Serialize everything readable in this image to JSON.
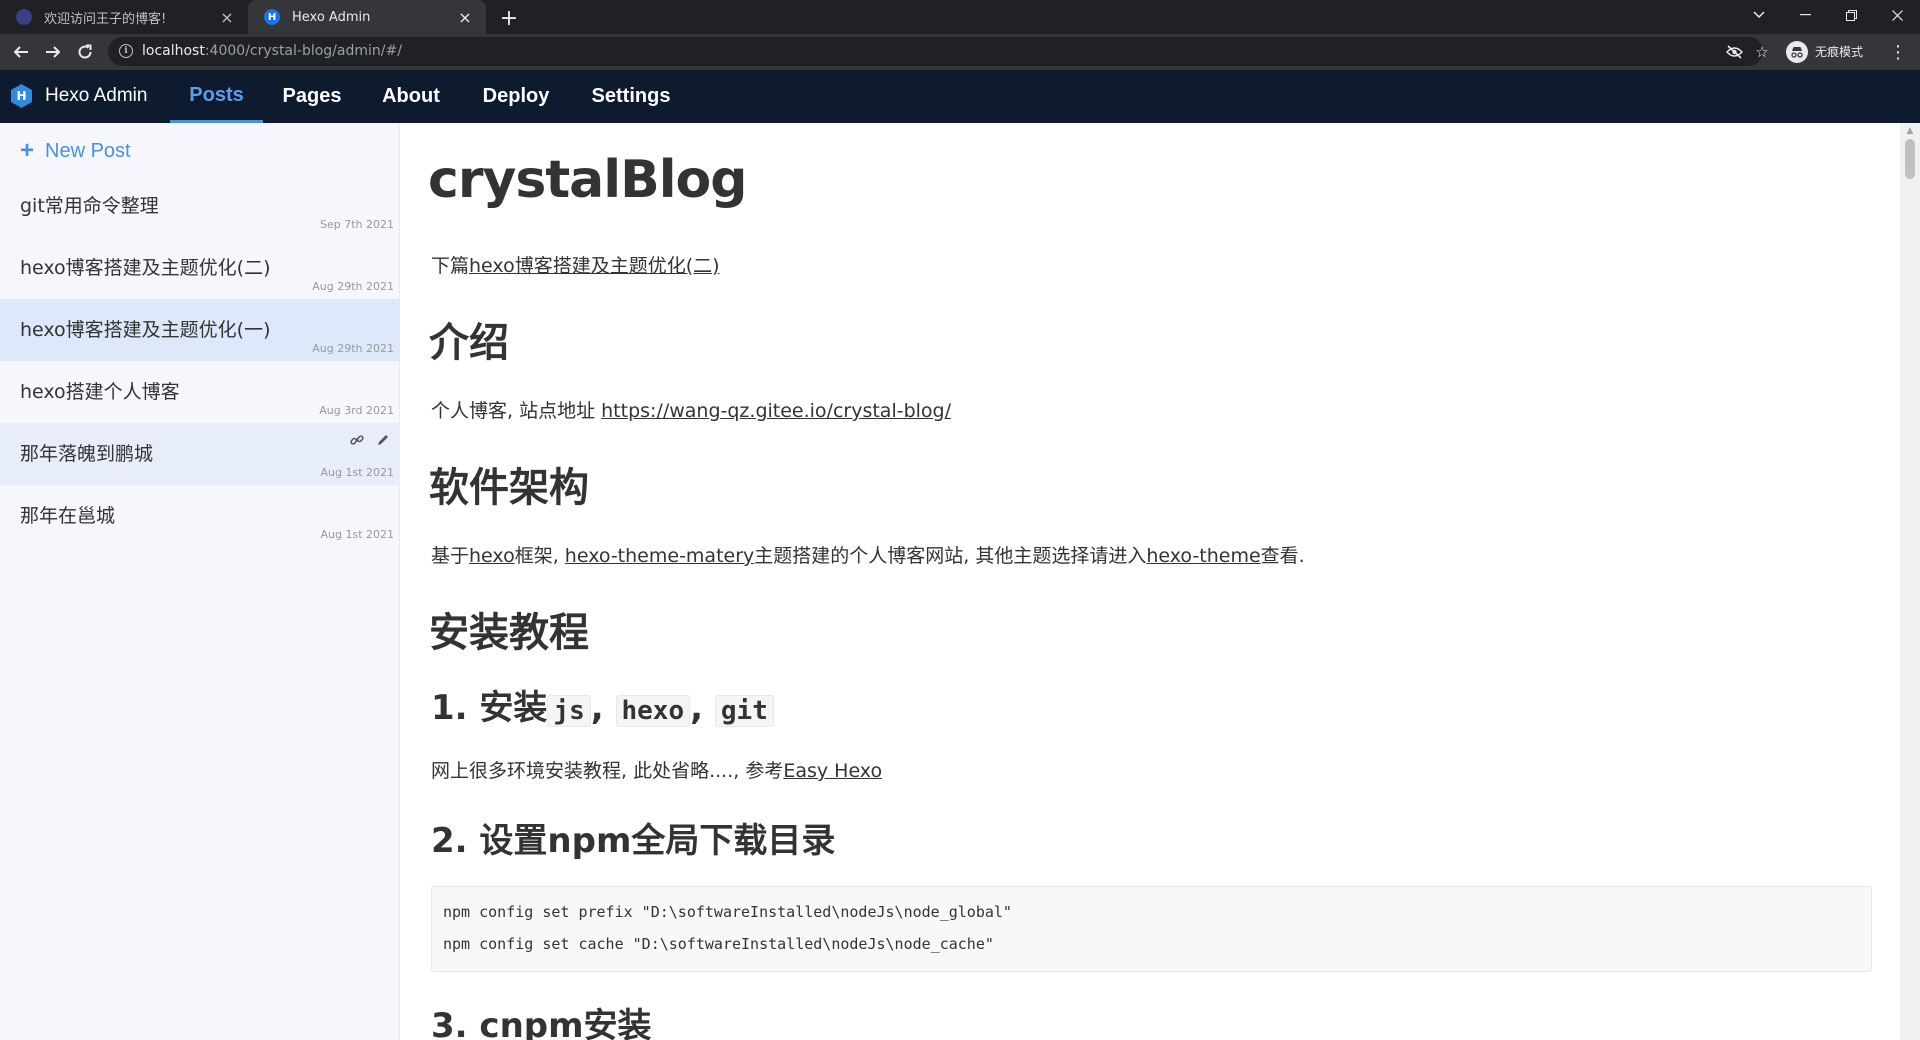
{
  "browser": {
    "tabs": [
      {
        "title": "欢迎访问王子的博客!",
        "favicon_icon": "blog-favicon-icon"
      },
      {
        "title": "Hexo Admin",
        "favicon_icon": "hexo-favicon-icon",
        "favicon_letter": "H"
      }
    ],
    "url_host": "localhost",
    "url_path": ":4000/crystal-blog/admin/#/",
    "incognito_label": "无痕模式",
    "icons": [
      "back-arrow-icon",
      "forward-arrow-icon",
      "reload-icon",
      "info-icon",
      "eye-off-icon",
      "star-icon",
      "incognito-icon",
      "kebab-menu-icon"
    ]
  },
  "app": {
    "brand": "Hexo Admin",
    "logo_letter": "H",
    "nav": [
      "Posts",
      "Pages",
      "About",
      "Deploy",
      "Settings"
    ],
    "active_nav": "Posts",
    "accent_color": "#4a90e2",
    "header_color": "#0e1a2e"
  },
  "sidebar": {
    "new_post_label": "New Post",
    "posts": [
      {
        "title": "git常用命令整理",
        "date": "Sep 7th 2021"
      },
      {
        "title": "hexo博客搭建及主题优化(二)",
        "date": "Aug 29th 2021"
      },
      {
        "title": "hexo博客搭建及主题优化(一)",
        "date": "Aug 29th 2021"
      },
      {
        "title": "hexo搭建个人博客",
        "date": "Aug 3rd 2021"
      },
      {
        "title": "那年落魄到鹏城",
        "date": "Aug 1st 2021"
      },
      {
        "title": "那年在邕城",
        "date": "Aug 1st 2021"
      }
    ],
    "selected_index": 2,
    "hovered_index": 4
  },
  "content": {
    "title": "crystalBlog",
    "p1_prefix": "下篇",
    "p1_link": "hexo博客搭建及主题优化(二)",
    "h_intro": "介绍",
    "p2_text": "个人博客, 站点地址 ",
    "p2_link": "https://wang-qz.gitee.io/crystal-blog/",
    "h_arch": "软件架构",
    "p3_prefix": "基于",
    "p3_link1": "hexo",
    "p3_mid1": "框架, ",
    "p3_link2": "hexo-theme-matery",
    "p3_mid2": "主题搭建的个人博客网站, 其他主题选择请进入",
    "p3_link3": "hexo-theme",
    "p3_suffix": "查看.",
    "h_install": "安装教程",
    "h3_1_prefix": "1. 安装",
    "h3_1_code1": "js",
    "h3_1_sep1": ", ",
    "h3_1_code2": "hexo",
    "h3_1_sep2": ", ",
    "h3_1_code3": "git",
    "p4_text": "网上很多环境安装教程, 此处省略...., 参考",
    "p4_link": "Easy Hexo",
    "h3_2": "2. 设置npm全局下载目录",
    "code_lines": [
      "npm config set prefix \"D:\\softwareInstalled\\nodeJs\\node_global\"",
      "npm config set cache \"D:\\softwareInstalled\\nodeJs\\node_cache\""
    ],
    "h3_3": "3. cnpm安装"
  }
}
